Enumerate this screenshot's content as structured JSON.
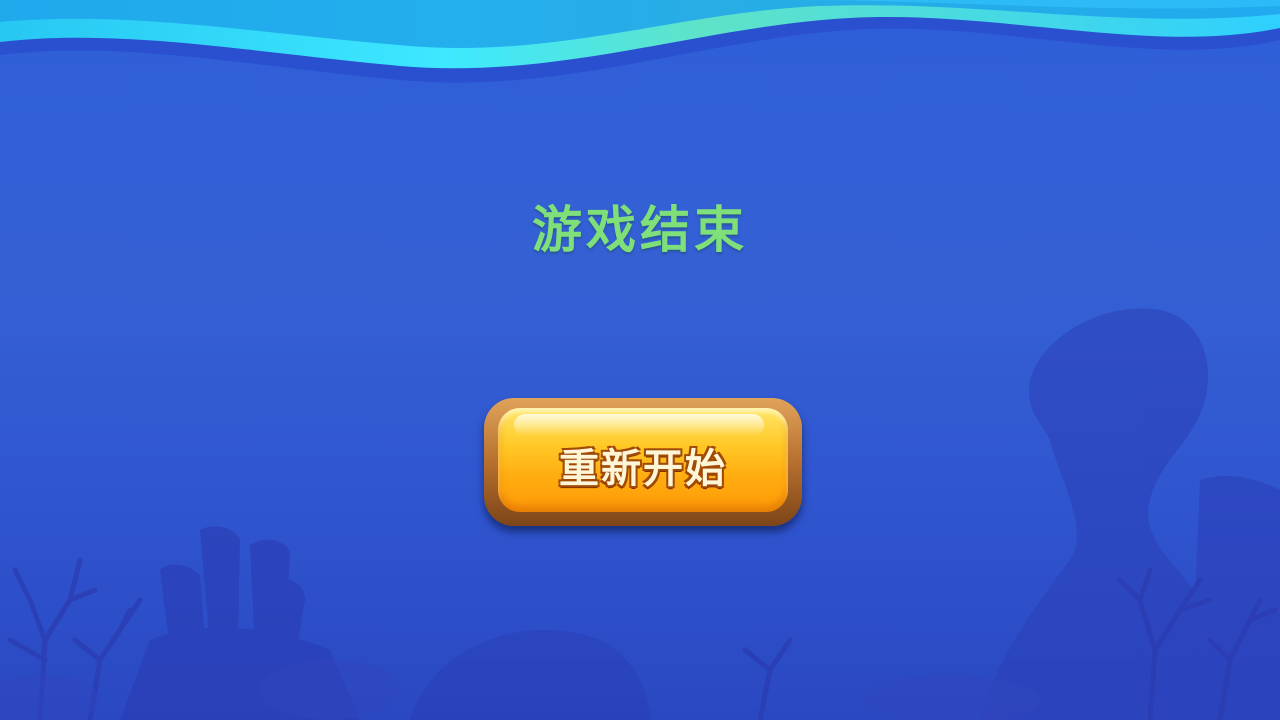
{
  "screen": {
    "title": "游戏结束",
    "restart_label": "重新开始"
  },
  "colors": {
    "background": "#3560d4",
    "title": "#7fe07a",
    "button_face": "#ffc928",
    "button_frame": "#b7702f",
    "wave_light": "#3ee8ff"
  },
  "icons": [
    "wave-decoration",
    "coral-reef-decoration",
    "rock-decoration"
  ]
}
